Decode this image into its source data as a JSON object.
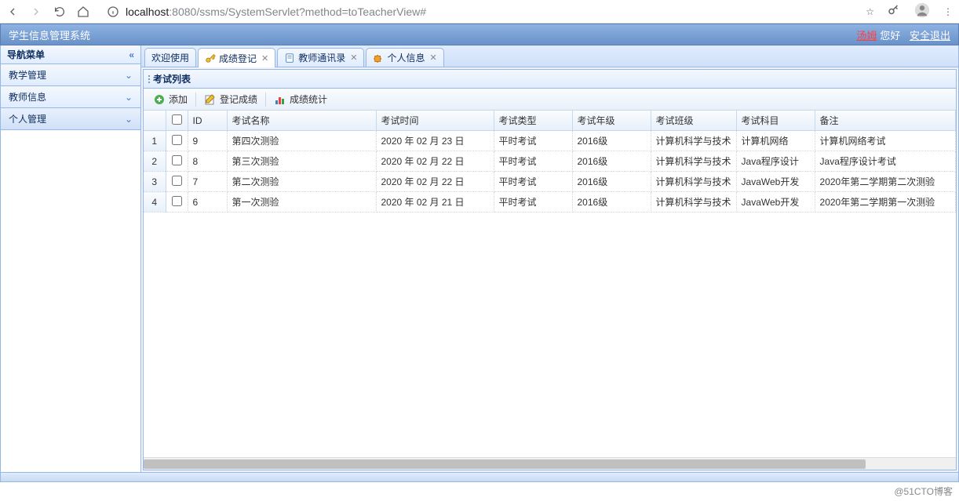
{
  "browser": {
    "url_host": "localhost",
    "url_port": ":8080",
    "url_path": "/ssms/SystemServlet?method=toTeacherView#"
  },
  "header": {
    "title": "学生信息管理系统",
    "username": "汤姆",
    "greeting": "您好",
    "logout": "安全退出"
  },
  "sidebar": {
    "title": "导航菜单",
    "items": [
      {
        "label": "教学管理"
      },
      {
        "label": "教师信息"
      },
      {
        "label": "个人管理"
      }
    ]
  },
  "tabs": [
    {
      "label": "欢迎使用",
      "closable": true,
      "icon": "none"
    },
    {
      "label": "成绩登记",
      "closable": true,
      "icon": "key",
      "active": true
    },
    {
      "label": "教师通讯录",
      "closable": true,
      "icon": "book"
    },
    {
      "label": "个人信息",
      "closable": true,
      "icon": "puzzle"
    }
  ],
  "panel": {
    "title": "考试列表"
  },
  "toolbar": {
    "add": "添加",
    "register": "登记成绩",
    "stats": "成绩统计"
  },
  "columns": [
    "ID",
    "考试名称",
    "考试时间",
    "考试类型",
    "考试年级",
    "考试班级",
    "考试科目",
    "备注"
  ],
  "rows": [
    {
      "num": "1",
      "id": "9",
      "name": "第四次测验",
      "time": "2020 年 02 月 23 日",
      "type": "平时考试",
      "grade": "2016级",
      "class": "计算机科学与技术",
      "subject": "计算机网络",
      "remark": "计算机网络考试"
    },
    {
      "num": "2",
      "id": "8",
      "name": "第三次测验",
      "time": "2020 年 02 月 22 日",
      "type": "平时考试",
      "grade": "2016级",
      "class": "计算机科学与技术",
      "subject": "Java程序设计",
      "remark": "Java程序设计考试"
    },
    {
      "num": "3",
      "id": "7",
      "name": "第二次测验",
      "time": "2020 年 02 月 22 日",
      "type": "平时考试",
      "grade": "2016级",
      "class": "计算机科学与技术",
      "subject": "JavaWeb开发",
      "remark": "2020年第二学期第二次测验"
    },
    {
      "num": "4",
      "id": "6",
      "name": "第一次测验",
      "time": "2020 年 02 月 21 日",
      "type": "平时考试",
      "grade": "2016级",
      "class": "计算机科学与技术",
      "subject": "JavaWeb开发",
      "remark": "2020年第二学期第一次测验"
    }
  ],
  "watermark": "@51CTO博客"
}
